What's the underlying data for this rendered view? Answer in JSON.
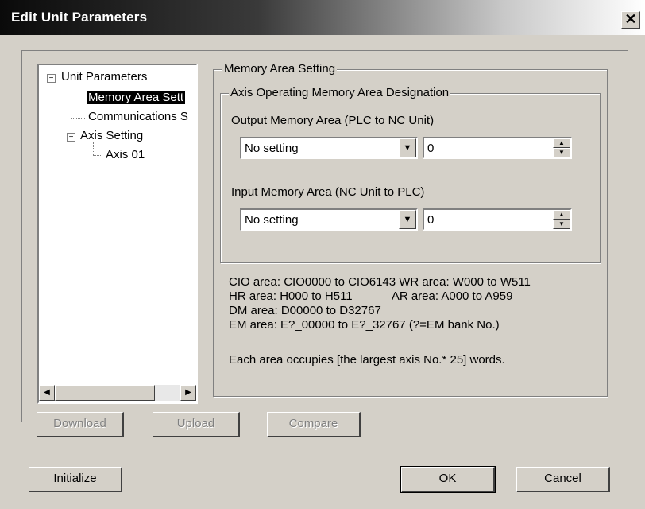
{
  "window": {
    "title": "Edit Unit Parameters",
    "close_glyph": "✕"
  },
  "tree": {
    "items": [
      {
        "label": "Unit Parameters",
        "expander": "−"
      },
      {
        "label": "Memory Area Sett"
      },
      {
        "label": "Communications S"
      },
      {
        "label": "Axis Setting",
        "expander": "−"
      },
      {
        "label": "Axis 01"
      }
    ],
    "scroll_left_glyph": "◀",
    "scroll_right_glyph": "▶"
  },
  "memory_area": {
    "group_title": "Memory Area Setting",
    "axis_group_title": "Axis Operating Memory Area Designation",
    "output": {
      "label": "Output Memory Area (PLC to NC Unit)",
      "area_value": "No setting",
      "address_value": "0"
    },
    "input": {
      "label": "Input Memory Area (NC Unit to PLC)",
      "area_value": "No setting",
      "address_value": "0"
    },
    "info_lines": [
      "CIO area: CIO0000 to CIO6143   WR area: W000 to W511",
      "HR area: H000 to H511            AR area: A000 to A959",
      "DM area: D00000 to D32767",
      "EM area: E?_00000 to E?_32767 (?=EM bank No.)"
    ],
    "note": "Each area occupies [the largest axis No.* 25] words."
  },
  "icons": {
    "dropdown": "▼",
    "spin_up": "▲",
    "spin_down": "▼"
  },
  "buttons": {
    "download": "Download",
    "upload": "Upload",
    "compare": "Compare",
    "initialize": "Initialize",
    "ok": "OK",
    "cancel": "Cancel"
  }
}
